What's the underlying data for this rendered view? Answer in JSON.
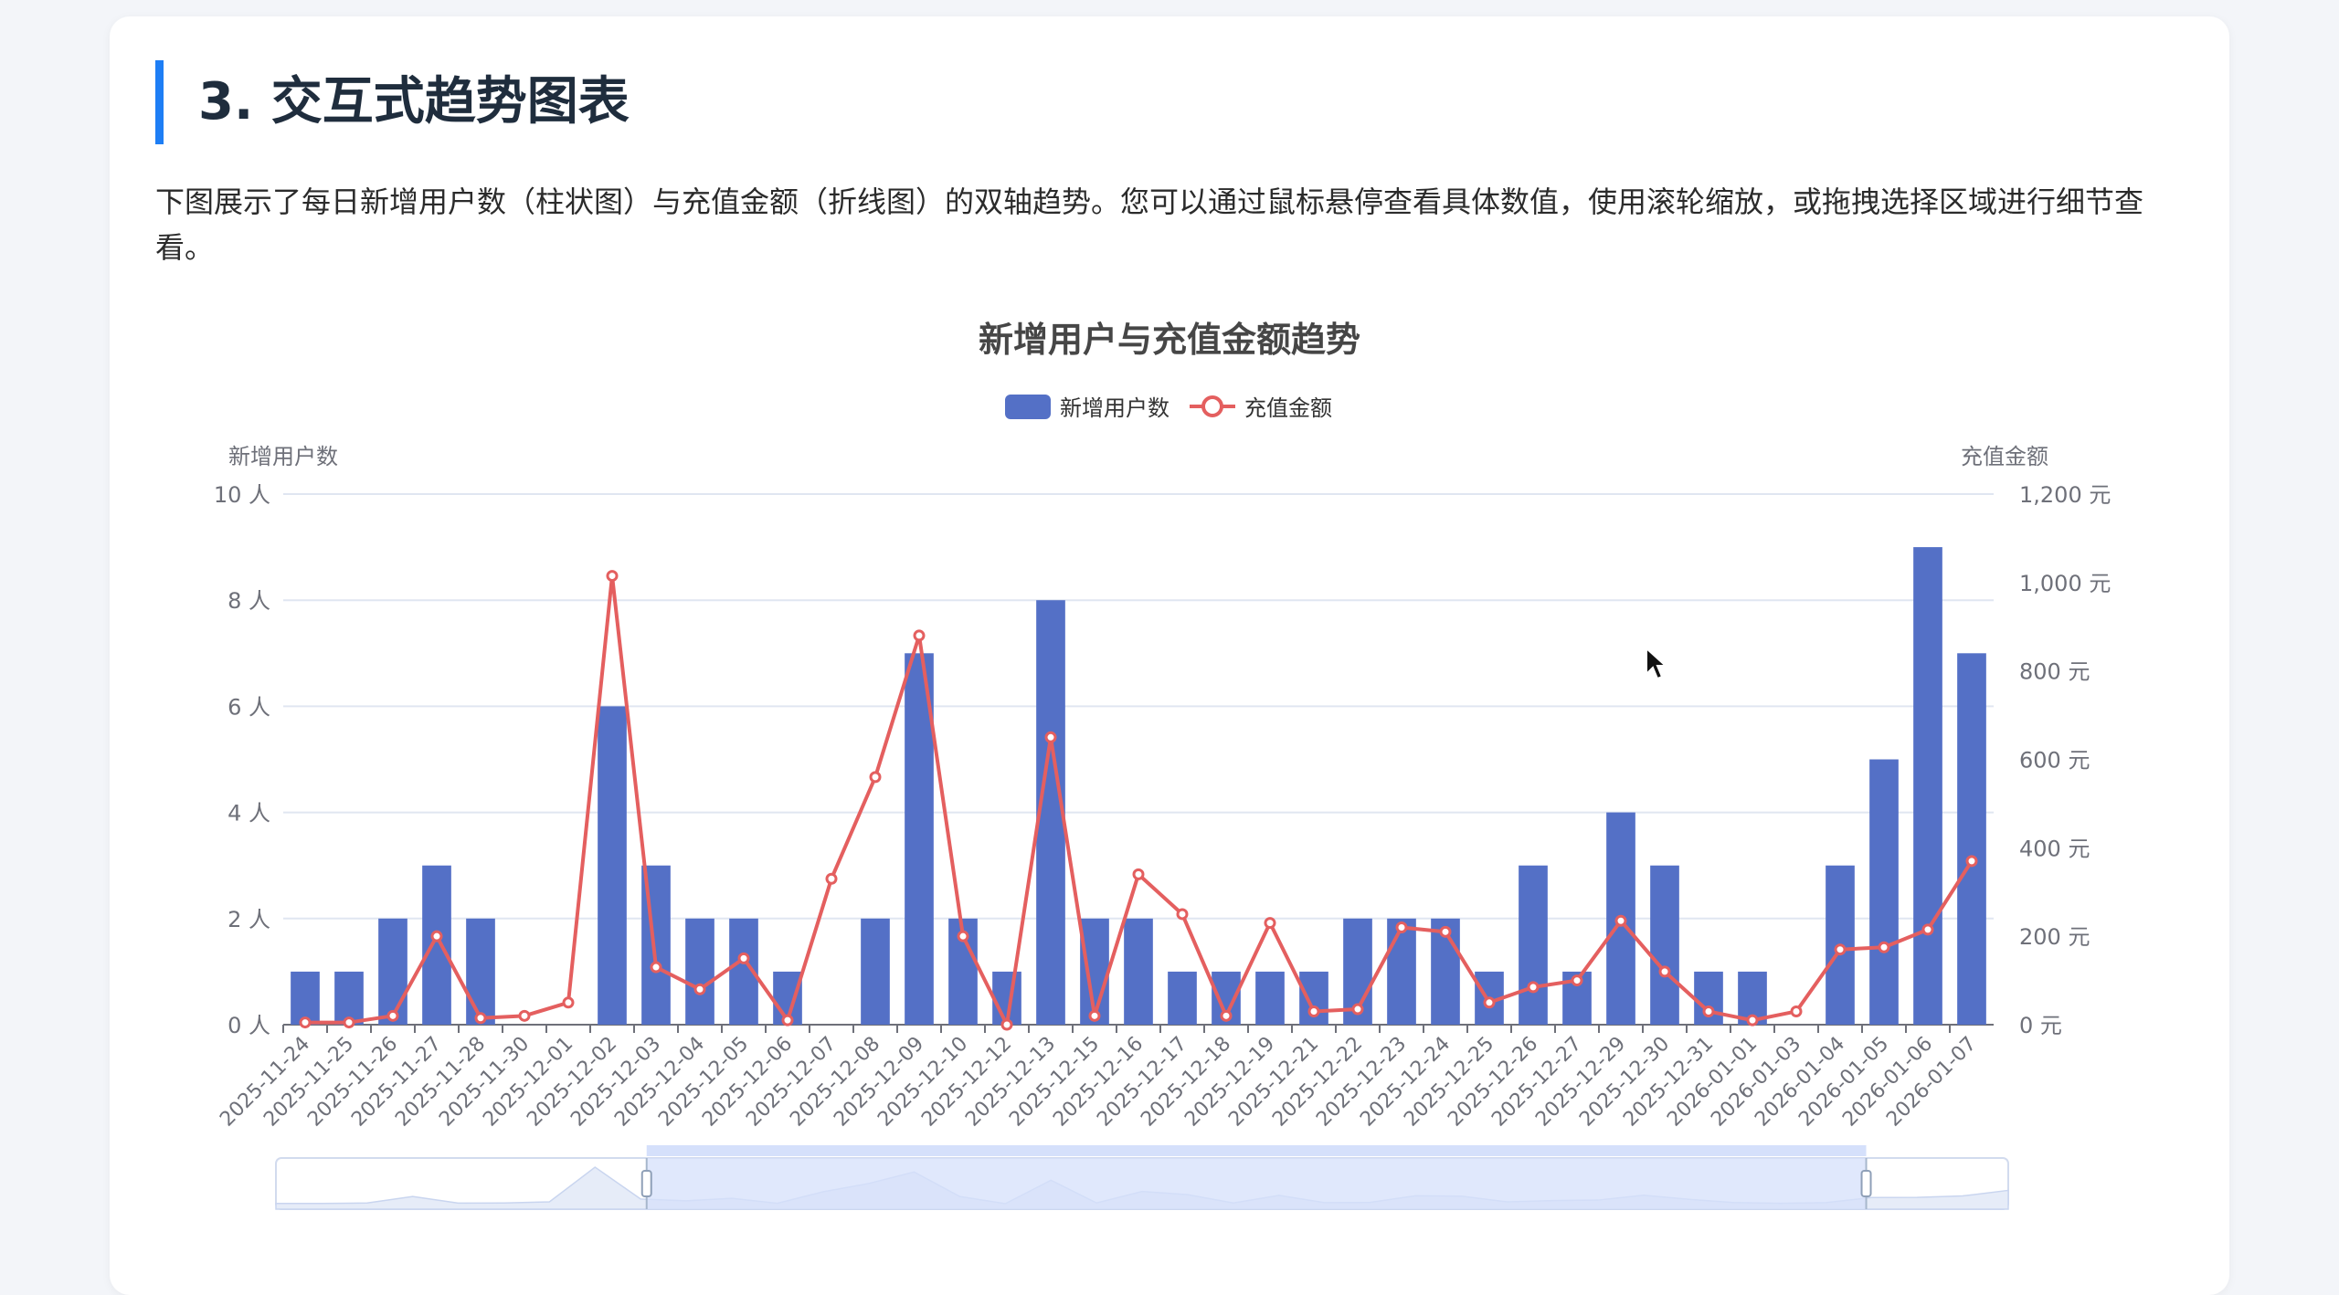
{
  "section": {
    "title": "3. 交互式趋势图表",
    "description": "下图展示了每日新增用户数（柱状图）与充值金额（折线图）的双轴趋势。您可以通过鼠标悬停查看具体数值，使用滚轮缩放，或拖拽选择区域进行细节查看。"
  },
  "chart_data": {
    "type": "bar",
    "title": "新增用户与充值金额趋势",
    "legend": {
      "position": "top-center",
      "items": [
        "新增用户数",
        "充值金额"
      ]
    },
    "categories": [
      "2025-11-24",
      "2025-11-25",
      "2025-11-26",
      "2025-11-27",
      "2025-11-28",
      "2025-11-30",
      "2025-12-01",
      "2025-12-02",
      "2025-12-03",
      "2025-12-04",
      "2025-12-05",
      "2025-12-06",
      "2025-12-07",
      "2025-12-08",
      "2025-12-09",
      "2025-12-10",
      "2025-12-12",
      "2025-12-13",
      "2025-12-15",
      "2025-12-16",
      "2025-12-17",
      "2025-12-18",
      "2025-12-19",
      "2025-12-21",
      "2025-12-22",
      "2025-12-23",
      "2025-12-24",
      "2025-12-25",
      "2025-12-26",
      "2025-12-27",
      "2025-12-29",
      "2025-12-30",
      "2025-12-31",
      "2026-01-01",
      "2026-01-03",
      "2026-01-04",
      "2026-01-05",
      "2026-01-06",
      "2026-01-07"
    ],
    "series": [
      {
        "name": "新增用户数",
        "type": "bar",
        "axis": "left",
        "color": "#5470c6",
        "values": [
          1,
          1,
          2,
          3,
          2,
          0,
          0,
          6,
          3,
          2,
          2,
          1,
          0,
          2,
          7,
          2,
          1,
          8,
          2,
          2,
          1,
          1,
          1,
          1,
          2,
          2,
          2,
          1,
          3,
          1,
          4,
          3,
          1,
          1,
          0,
          3,
          5,
          9,
          7
        ]
      },
      {
        "name": "充值金额",
        "type": "line",
        "axis": "right",
        "color": "#e45f5f",
        "values": [
          5,
          5,
          20,
          200,
          15,
          20,
          50,
          1015,
          130,
          80,
          150,
          10,
          330,
          560,
          880,
          200,
          0,
          650,
          20,
          340,
          250,
          20,
          230,
          30,
          35,
          220,
          210,
          50,
          85,
          100,
          235,
          120,
          30,
          10,
          30,
          170,
          175,
          215,
          370
        ]
      }
    ],
    "y_left": {
      "label": "新增用户数",
      "min": 0,
      "max": 10,
      "ticks": [
        0,
        2,
        4,
        6,
        8,
        10
      ],
      "unit": " 人"
    },
    "y_right": {
      "label": "充值金额",
      "min": 0,
      "max": 1200,
      "ticks": [
        "0 元",
        "200 元",
        "400 元",
        "600 元",
        "800 元",
        "1,000 元",
        "1,200 元"
      ],
      "tick_values": [
        0,
        200,
        400,
        600,
        800,
        1000,
        1200
      ]
    },
    "grid": true,
    "datazoom": {
      "start_fraction": 0.214,
      "end_fraction": 0.918
    },
    "colors": {
      "bar": "#5470c6",
      "line": "#e45f5f",
      "grid": "#e0e6f1",
      "axis_text": "#6e7079",
      "title": "#464646",
      "zoom_fill": "#d5e0fb",
      "zoom_border": "#d2dbee"
    }
  }
}
